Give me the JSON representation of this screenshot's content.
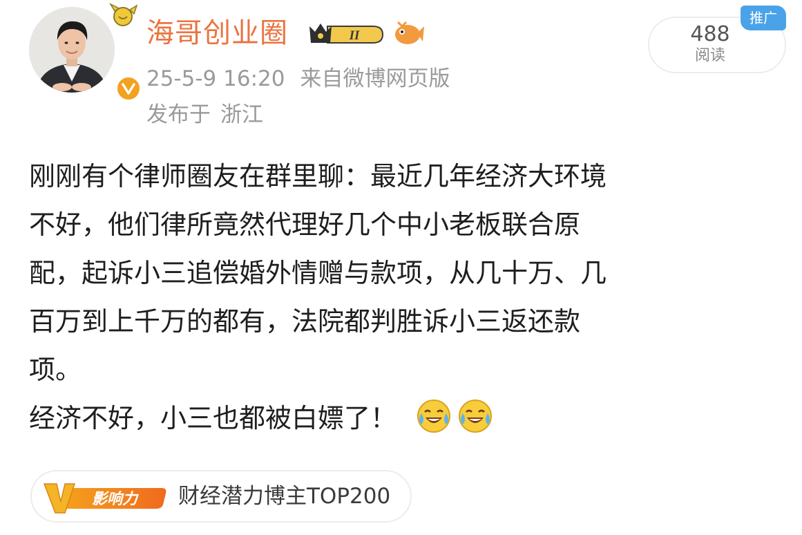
{
  "author": {
    "name": "海哥创业圈",
    "level_badge": "II",
    "avatar_icon": "avatar-photo-icon",
    "verified_icon": "verified-v-icon"
  },
  "meta": {
    "time": "25-5-9 16:20",
    "source": "来自微博网页版",
    "location_prefix": "发布于",
    "location": "浙江"
  },
  "stats": {
    "reads": "488",
    "reads_label": "阅读",
    "promo_tag": "推广"
  },
  "post": {
    "lines": [
      "刚刚有个律师圈友在群里聊：最近几年经济大环境",
      "不好，他们律所竟然代理好几个中小老板联合原",
      "配，起诉小三追偿婚外情赠与款项，从几十万、几",
      "百万到上千万的都有，法院都判胜诉小三返还款",
      "项。"
    ],
    "last_line": "经济不好，小三也都被白嫖了！",
    "emojis": [
      "laugh-cry-emoji",
      "laugh-cry-emoji"
    ]
  },
  "influence": {
    "logo_text": "影响力",
    "logo_icon": "influence-v-icon",
    "label": "财经潜力博主TOP200"
  },
  "colors": {
    "username": "#eb7340",
    "meta": "#9a9a9a",
    "body": "#1e1e1e",
    "promo": "#4aa3e8",
    "verified": "#f2a121"
  }
}
